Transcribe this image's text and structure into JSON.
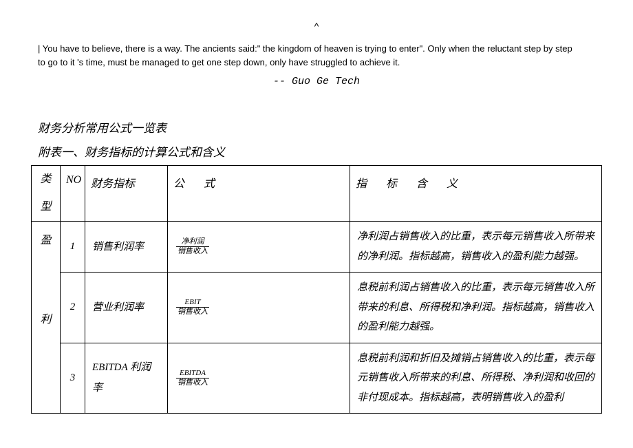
{
  "top_caret": "^",
  "intro": {
    "line1": "| You have to believe, there is a way. The ancients said:\" the kingdom of heaven is trying to enter\". Only when the reluctant step by step",
    "line2": "to go to it 's time, must be managed to get one step down, only have struggled to achieve it."
  },
  "author": "-- Guo Ge Tech",
  "title_main": "财务分析常用公式一览表",
  "title_sub": "附表一、财务指标的计算公式和含义",
  "table": {
    "headers": {
      "type_t": "类",
      "type_b": "型",
      "no": "NO",
      "indicator": "财务指标",
      "formula": "公  式",
      "meaning": "指 标 含 义"
    },
    "type_col": {
      "char1": "盈",
      "char2": "利"
    },
    "rows": [
      {
        "no": "1",
        "indicator": "销售利润率",
        "formula_num": "净利润",
        "formula_den": "销售收入",
        "meaning": "净利润占销售收入的比重，表示每元销售收入所带来的净利润。指标越高，销售收入的盈利能力越强。"
      },
      {
        "no": "2",
        "indicator": "营业利润率",
        "formula_num": "EBIT",
        "formula_den": "销售收入",
        "meaning": "息税前利润占销售收入的比重，表示每元销售收入所带来的利息、所得税和净利润。指标越高，销售收入的盈利能力越强。"
      },
      {
        "no": "3",
        "indicator": "EBITDA 利润率",
        "formula_num": "EBITDA",
        "formula_den": "销售收入",
        "meaning": "息税前利润和折旧及摊销占销售收入的比重，表示每元销售收入所带来的利息、所得税、净利润和收回的非付现成本。指标越高，表明销售收入的盈利"
      }
    ]
  }
}
